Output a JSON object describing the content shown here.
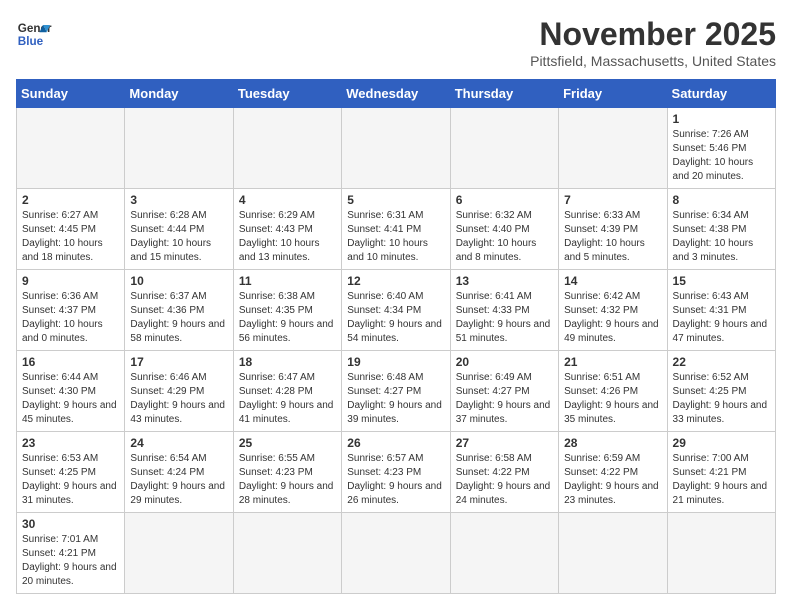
{
  "header": {
    "logo_line1": "General",
    "logo_line2": "Blue",
    "title": "November 2025",
    "subtitle": "Pittsfield, Massachusetts, United States"
  },
  "days_of_week": [
    "Sunday",
    "Monday",
    "Tuesday",
    "Wednesday",
    "Thursday",
    "Friday",
    "Saturday"
  ],
  "weeks": [
    [
      {
        "day": "",
        "info": "",
        "empty": true
      },
      {
        "day": "",
        "info": "",
        "empty": true
      },
      {
        "day": "",
        "info": "",
        "empty": true
      },
      {
        "day": "",
        "info": "",
        "empty": true
      },
      {
        "day": "",
        "info": "",
        "empty": true
      },
      {
        "day": "",
        "info": "",
        "empty": true
      },
      {
        "day": "1",
        "info": "Sunrise: 7:26 AM\nSunset: 5:46 PM\nDaylight: 10 hours and 20 minutes.",
        "empty": false
      }
    ],
    [
      {
        "day": "2",
        "info": "Sunrise: 6:27 AM\nSunset: 4:45 PM\nDaylight: 10 hours and 18 minutes.",
        "empty": false
      },
      {
        "day": "3",
        "info": "Sunrise: 6:28 AM\nSunset: 4:44 PM\nDaylight: 10 hours and 15 minutes.",
        "empty": false
      },
      {
        "day": "4",
        "info": "Sunrise: 6:29 AM\nSunset: 4:43 PM\nDaylight: 10 hours and 13 minutes.",
        "empty": false
      },
      {
        "day": "5",
        "info": "Sunrise: 6:31 AM\nSunset: 4:41 PM\nDaylight: 10 hours and 10 minutes.",
        "empty": false
      },
      {
        "day": "6",
        "info": "Sunrise: 6:32 AM\nSunset: 4:40 PM\nDaylight: 10 hours and 8 minutes.",
        "empty": false
      },
      {
        "day": "7",
        "info": "Sunrise: 6:33 AM\nSunset: 4:39 PM\nDaylight: 10 hours and 5 minutes.",
        "empty": false
      },
      {
        "day": "8",
        "info": "Sunrise: 6:34 AM\nSunset: 4:38 PM\nDaylight: 10 hours and 3 minutes.",
        "empty": false
      }
    ],
    [
      {
        "day": "9",
        "info": "Sunrise: 6:36 AM\nSunset: 4:37 PM\nDaylight: 10 hours and 0 minutes.",
        "empty": false
      },
      {
        "day": "10",
        "info": "Sunrise: 6:37 AM\nSunset: 4:36 PM\nDaylight: 9 hours and 58 minutes.",
        "empty": false
      },
      {
        "day": "11",
        "info": "Sunrise: 6:38 AM\nSunset: 4:35 PM\nDaylight: 9 hours and 56 minutes.",
        "empty": false
      },
      {
        "day": "12",
        "info": "Sunrise: 6:40 AM\nSunset: 4:34 PM\nDaylight: 9 hours and 54 minutes.",
        "empty": false
      },
      {
        "day": "13",
        "info": "Sunrise: 6:41 AM\nSunset: 4:33 PM\nDaylight: 9 hours and 51 minutes.",
        "empty": false
      },
      {
        "day": "14",
        "info": "Sunrise: 6:42 AM\nSunset: 4:32 PM\nDaylight: 9 hours and 49 minutes.",
        "empty": false
      },
      {
        "day": "15",
        "info": "Sunrise: 6:43 AM\nSunset: 4:31 PM\nDaylight: 9 hours and 47 minutes.",
        "empty": false
      }
    ],
    [
      {
        "day": "16",
        "info": "Sunrise: 6:44 AM\nSunset: 4:30 PM\nDaylight: 9 hours and 45 minutes.",
        "empty": false
      },
      {
        "day": "17",
        "info": "Sunrise: 6:46 AM\nSunset: 4:29 PM\nDaylight: 9 hours and 43 minutes.",
        "empty": false
      },
      {
        "day": "18",
        "info": "Sunrise: 6:47 AM\nSunset: 4:28 PM\nDaylight: 9 hours and 41 minutes.",
        "empty": false
      },
      {
        "day": "19",
        "info": "Sunrise: 6:48 AM\nSunset: 4:27 PM\nDaylight: 9 hours and 39 minutes.",
        "empty": false
      },
      {
        "day": "20",
        "info": "Sunrise: 6:49 AM\nSunset: 4:27 PM\nDaylight: 9 hours and 37 minutes.",
        "empty": false
      },
      {
        "day": "21",
        "info": "Sunrise: 6:51 AM\nSunset: 4:26 PM\nDaylight: 9 hours and 35 minutes.",
        "empty": false
      },
      {
        "day": "22",
        "info": "Sunrise: 6:52 AM\nSunset: 4:25 PM\nDaylight: 9 hours and 33 minutes.",
        "empty": false
      }
    ],
    [
      {
        "day": "23",
        "info": "Sunrise: 6:53 AM\nSunset: 4:25 PM\nDaylight: 9 hours and 31 minutes.",
        "empty": false
      },
      {
        "day": "24",
        "info": "Sunrise: 6:54 AM\nSunset: 4:24 PM\nDaylight: 9 hours and 29 minutes.",
        "empty": false
      },
      {
        "day": "25",
        "info": "Sunrise: 6:55 AM\nSunset: 4:23 PM\nDaylight: 9 hours and 28 minutes.",
        "empty": false
      },
      {
        "day": "26",
        "info": "Sunrise: 6:57 AM\nSunset: 4:23 PM\nDaylight: 9 hours and 26 minutes.",
        "empty": false
      },
      {
        "day": "27",
        "info": "Sunrise: 6:58 AM\nSunset: 4:22 PM\nDaylight: 9 hours and 24 minutes.",
        "empty": false
      },
      {
        "day": "28",
        "info": "Sunrise: 6:59 AM\nSunset: 4:22 PM\nDaylight: 9 hours and 23 minutes.",
        "empty": false
      },
      {
        "day": "29",
        "info": "Sunrise: 7:00 AM\nSunset: 4:21 PM\nDaylight: 9 hours and 21 minutes.",
        "empty": false
      }
    ],
    [
      {
        "day": "30",
        "info": "Sunrise: 7:01 AM\nSunset: 4:21 PM\nDaylight: 9 hours and 20 minutes.",
        "empty": false
      },
      {
        "day": "",
        "info": "",
        "empty": true
      },
      {
        "day": "",
        "info": "",
        "empty": true
      },
      {
        "day": "",
        "info": "",
        "empty": true
      },
      {
        "day": "",
        "info": "",
        "empty": true
      },
      {
        "day": "",
        "info": "",
        "empty": true
      },
      {
        "day": "",
        "info": "",
        "empty": true
      }
    ]
  ]
}
